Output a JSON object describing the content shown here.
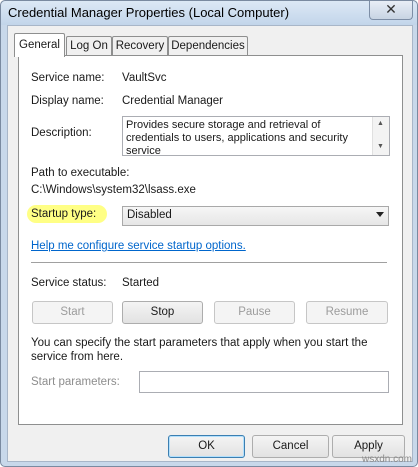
{
  "window": {
    "title": "Credential Manager Properties (Local Computer)",
    "close_glyph": "✕"
  },
  "tabs": [
    {
      "label": "General",
      "active": true
    },
    {
      "label": "Log On",
      "active": false
    },
    {
      "label": "Recovery",
      "active": false
    },
    {
      "label": "Dependencies",
      "active": false
    }
  ],
  "general": {
    "service_name_label": "Service name:",
    "service_name": "VaultSvc",
    "display_name_label": "Display name:",
    "display_name": "Credential Manager",
    "description_label": "Description:",
    "description": "Provides secure storage and retrieval of credentials to users, applications and security service",
    "path_label": "Path to executable:",
    "path": "C:\\Windows\\system32\\lsass.exe",
    "startup_type_label": "Startup type:",
    "startup_type": "Disabled",
    "help_link": "Help me configure service startup options.",
    "status_label": "Service status:",
    "status": "Started",
    "start_note": "You can specify the start parameters that apply when you start the service from here.",
    "start_params_label": "Start parameters:",
    "start_params_value": ""
  },
  "service_buttons": {
    "start": "Start",
    "stop": "Stop",
    "pause": "Pause",
    "resume": "Resume"
  },
  "dialog_buttons": {
    "ok": "OK",
    "cancel": "Cancel",
    "apply": "Apply"
  },
  "highlight_color": "#ffff66",
  "watermark": "wsxdn.com"
}
